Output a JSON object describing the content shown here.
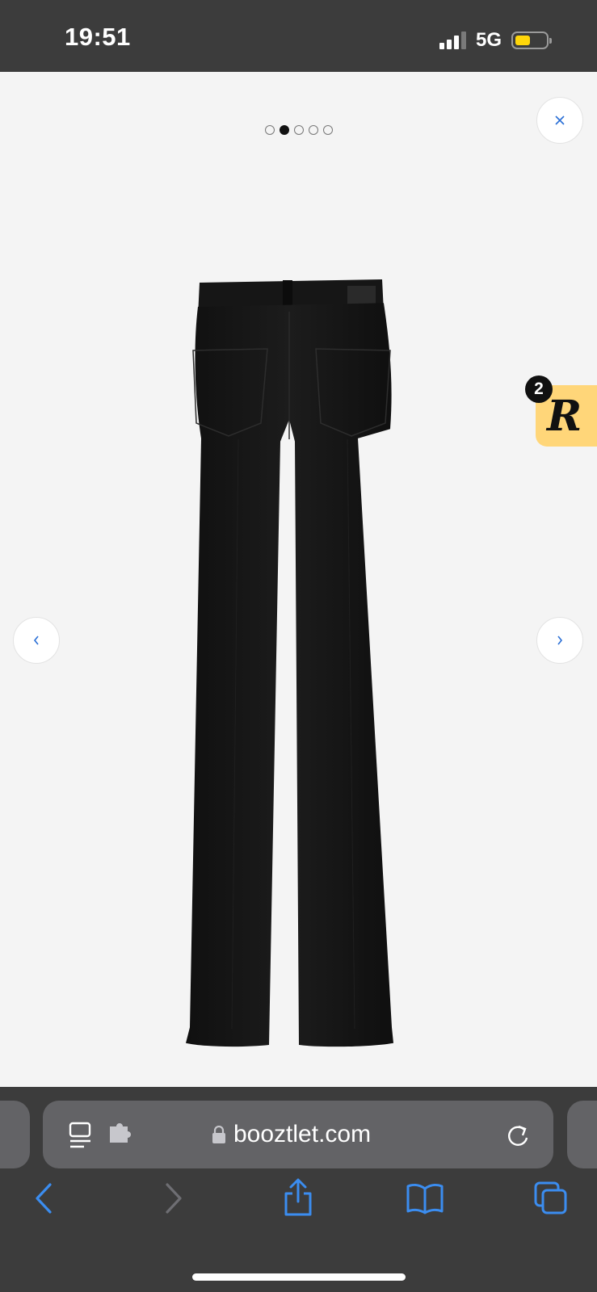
{
  "status_bar": {
    "time": "19:51",
    "network": "5G",
    "battery_color": "#ffd60a"
  },
  "gallery": {
    "image_count": 5,
    "active_index": 1,
    "product_image": "black-flared-jeans-back-view",
    "icons": {
      "close": "close-icon",
      "prev": "chevron-left-icon",
      "next": "chevron-right-icon"
    }
  },
  "badge": {
    "count": "2",
    "logo_letter": "R",
    "background": "#ffd679"
  },
  "safari": {
    "url": "booztlet.com",
    "accent": "#3b8df0",
    "icons": {
      "page_menu": "page-menu-icon",
      "extension": "extension-icon",
      "lock": "lock-icon",
      "reload": "reload-icon",
      "back": "back-arrow-icon",
      "forward": "forward-arrow-icon",
      "share": "share-icon",
      "bookmarks": "bookmarks-icon",
      "tabs": "tabs-icon"
    }
  }
}
